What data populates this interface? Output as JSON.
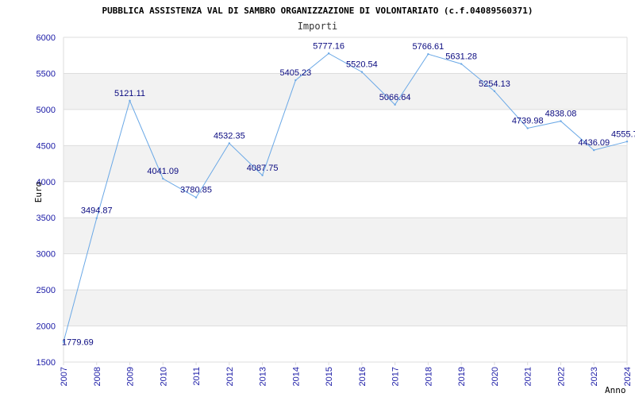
{
  "chart_data": {
    "type": "line",
    "title": "PUBBLICA ASSISTENZA VAL DI SAMBRO ORGANIZZAZIONE DI VOLONTARIATO (c.f.04089560371)",
    "subtitle": "Importi",
    "xlabel": "Anno",
    "ylabel": "Euro",
    "ylim": [
      1500,
      6000
    ],
    "yticks": [
      1500,
      2000,
      2500,
      3000,
      3500,
      4000,
      4500,
      5000,
      5500,
      6000
    ],
    "grid": "horizontal bands",
    "legend": "none",
    "series": [
      {
        "x": [
          "2007",
          "2008",
          "2009",
          "2010",
          "2011",
          "2012",
          "2013",
          "2014",
          "2015",
          "2016",
          "2017",
          "2018",
          "2019",
          "2020",
          "2021",
          "2022",
          "2023",
          "2024"
        ],
        "values": [
          1779.69,
          3494.87,
          5121.11,
          4041.09,
          3780.85,
          4532.35,
          4087.75,
          5405.23,
          5777.16,
          5520.54,
          5066.64,
          5766.61,
          5631.28,
          5254.13,
          4739.98,
          4838.08,
          4436.09,
          4555.7
        ],
        "labels": [
          "1779.69",
          "3494.87",
          "5121.11",
          "4041.09",
          "3780.85",
          "4532.35",
          "4087.75",
          "5405.23",
          "5777.16",
          "5520.54",
          "5066.64",
          "5766.61",
          "5631.28",
          "5254.13",
          "4739.98",
          "4838.08",
          "4436.09",
          "4555.7"
        ]
      }
    ],
    "colors": {
      "line": "#6aa8e6",
      "band": "#f2f2f2",
      "grid": "#dddddd",
      "tick_text": "#1a1aa6",
      "label_text": "#0a0a80"
    }
  }
}
